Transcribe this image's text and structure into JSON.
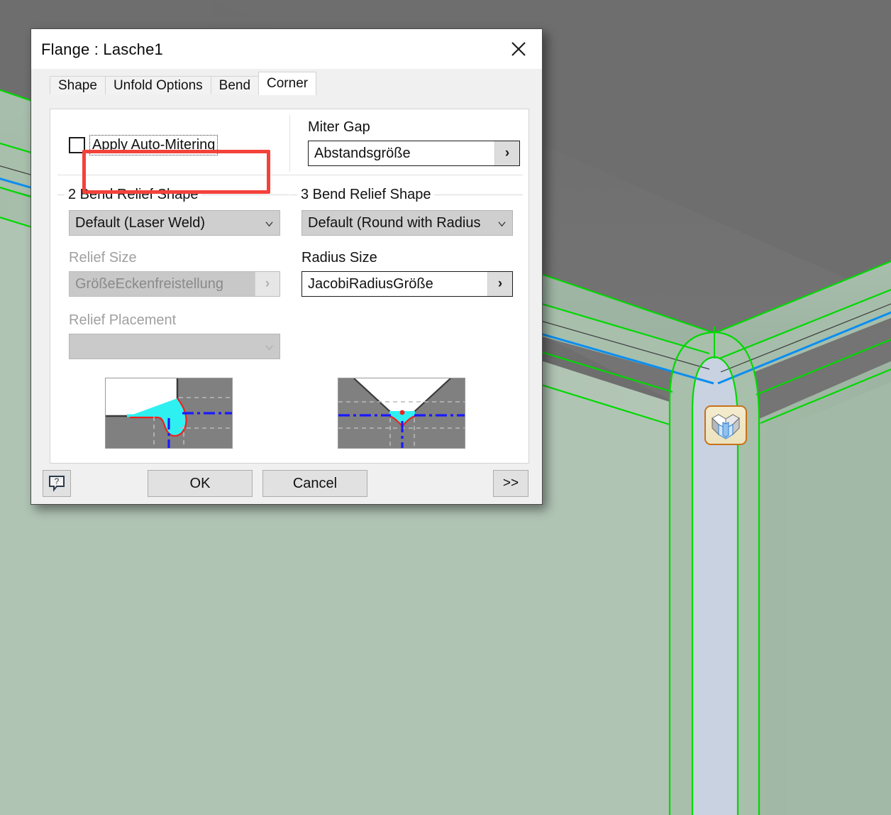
{
  "dialog": {
    "title": "Flange : Lasche1",
    "close_icon": "close-icon",
    "tabs": [
      {
        "label": "Shape",
        "active": false
      },
      {
        "label": "Unfold Options",
        "active": false
      },
      {
        "label": "Bend",
        "active": false
      },
      {
        "label": "Corner",
        "active": true
      }
    ],
    "corner_tab": {
      "auto_mitering": {
        "label": "Apply Auto-Mitering",
        "checked": false,
        "focused": true,
        "highlight_color": "#f3423a"
      },
      "miter_gap": {
        "label": "Miter Gap",
        "value": "Abstandsgröße",
        "button_glyph": "›",
        "enabled": true
      },
      "bend2": {
        "group_title": "2 Bend Relief Shape",
        "shape_value": "Default (Laser Weld)",
        "relief_size_label": "Relief Size",
        "relief_size_value": "GrößeEckenfreistellung",
        "relief_size_enabled": false,
        "relief_placement_label": "Relief Placement",
        "relief_placement_value": "",
        "relief_placement_enabled": false,
        "preview_name": "laser-weld-relief-preview"
      },
      "bend3": {
        "group_title": "3 Bend Relief Shape",
        "shape_value": "Default (Round with Radius",
        "radius_size_label": "Radius Size",
        "radius_size_value": "JacobiRadiusGröße",
        "radius_size_enabled": true,
        "preview_name": "round-radius-relief-preview"
      }
    },
    "footer": {
      "help_label": "?",
      "ok_label": "OK",
      "cancel_label": "Cancel",
      "more_label": ">>"
    }
  },
  "viewport": {
    "background_color": "#6e6e6e",
    "floor_color": "#ccd6e6",
    "face_color": "#9fb5a3",
    "edge_color": "#00d900",
    "highlight_edge_color": "#0a8ef0",
    "badge": {
      "name": "corner-relief-badge",
      "border_color": "#c8721a",
      "fill_color": "#f0e8c8"
    }
  }
}
